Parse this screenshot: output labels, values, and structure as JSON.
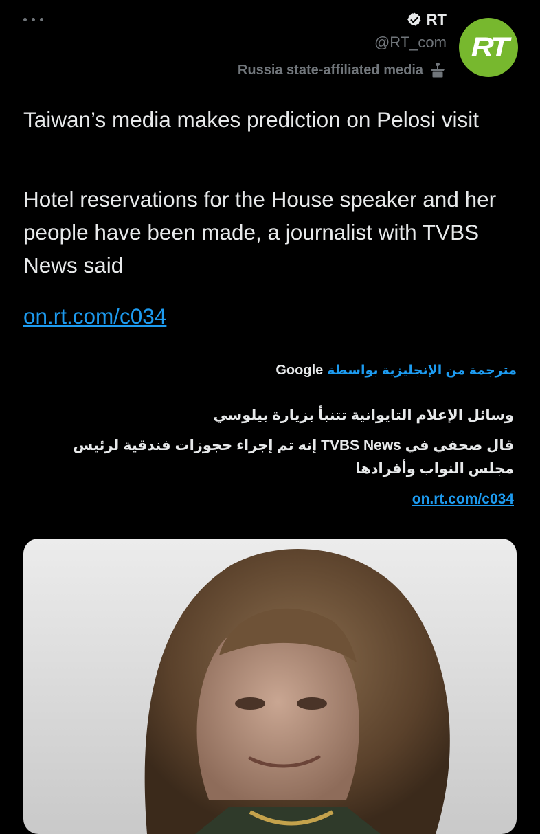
{
  "author": {
    "name": "RT",
    "handle": "@RT_com",
    "label": "Russia state-affiliated media",
    "avatar_text": "RT",
    "verified_icon": "verified-badge-icon",
    "label_icon": "podium-icon"
  },
  "menu": {
    "icon": "more-horizontal-icon"
  },
  "tweet": {
    "title": "Taiwan’s media makes prediction on Pelosi visit",
    "summary": "Hotel reservations for the House speaker and her people have been made, a journalist with TVBS News said",
    "link": "on.rt.com/c034"
  },
  "translation": {
    "translated_by": "مترجمة من الإنجليزية بواسطة",
    "provider": "Google",
    "title": "وسائل الإعلام التايوانية تتنبأ بزيارة بيلوسي",
    "summary": "قال صحفي في TVBS News إنه تم إجراء حجوزات فندقية لرئيس مجلس النواب وأفرادها",
    "link": "on.rt.com/c034"
  },
  "colors": {
    "background": "#000000",
    "text": "#e7e9ea",
    "muted": "#71767b",
    "link": "#1d9bf0",
    "avatar": "#77b82e"
  }
}
